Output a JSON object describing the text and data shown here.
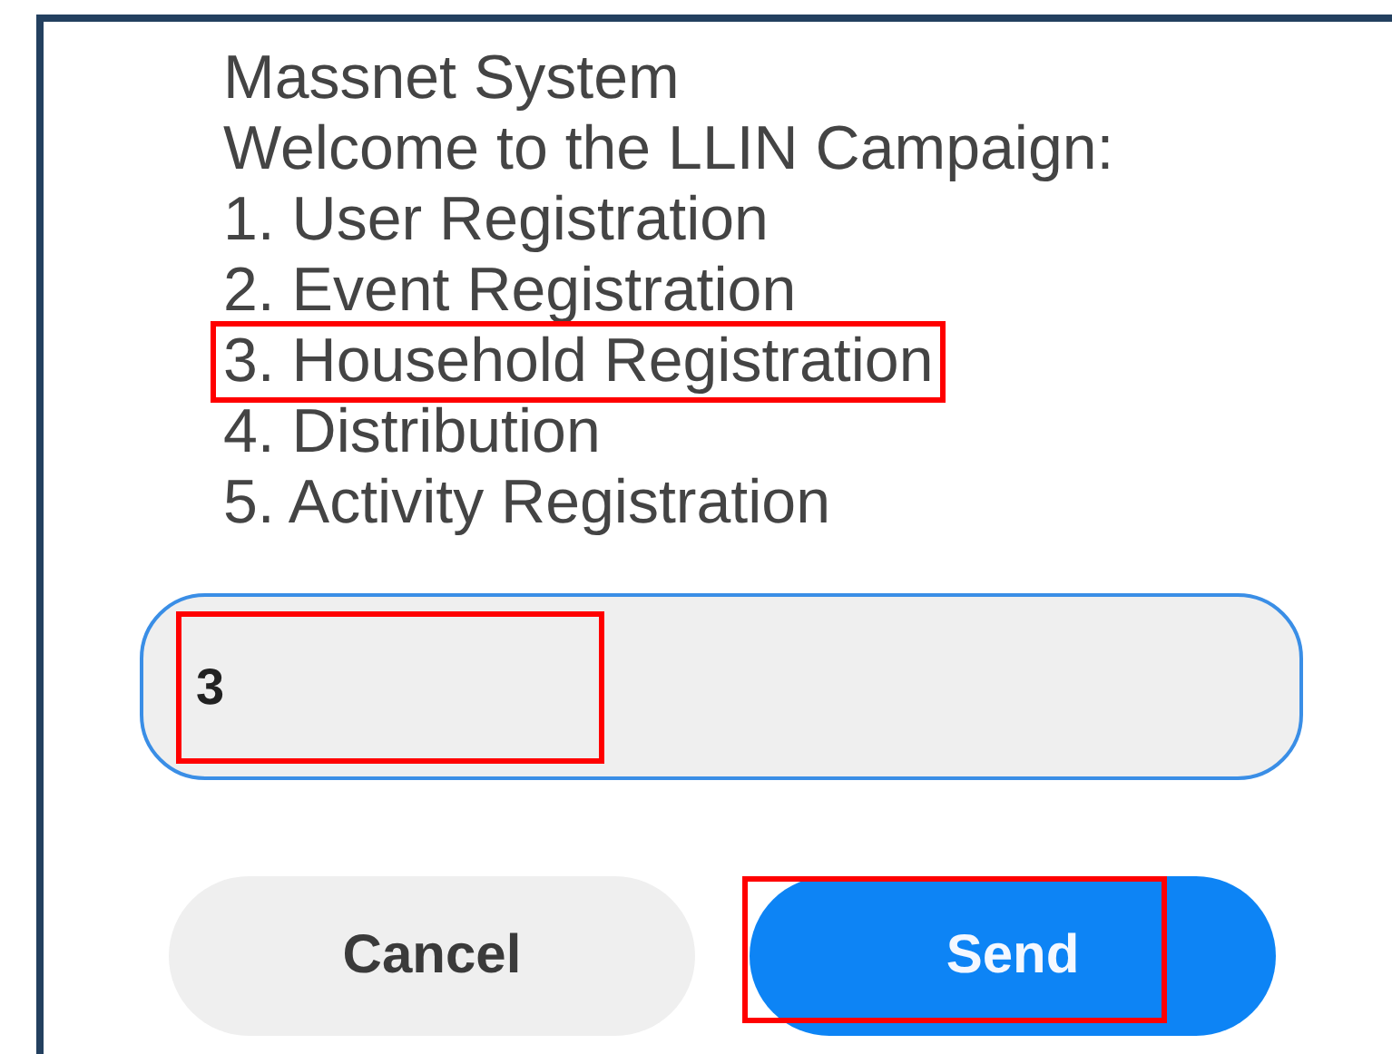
{
  "dialog": {
    "title": "Massnet System",
    "message": "Welcome to the LLIN Campaign:",
    "options": [
      {
        "label": "1. User Registration",
        "highlighted": false
      },
      {
        "label": "2. Event Registration",
        "highlighted": false
      },
      {
        "label": "3. Household Registration",
        "highlighted": true
      },
      {
        "label": "4. Distribution",
        "highlighted": false
      },
      {
        "label": "5. Activity Registration",
        "highlighted": false
      }
    ],
    "input": {
      "value": "3",
      "focused": true,
      "highlighted": true
    },
    "buttons": [
      {
        "label": "Cancel",
        "kind": "secondary",
        "highlighted": false
      },
      {
        "label": "Send",
        "kind": "primary",
        "highlighted": true
      }
    ]
  }
}
